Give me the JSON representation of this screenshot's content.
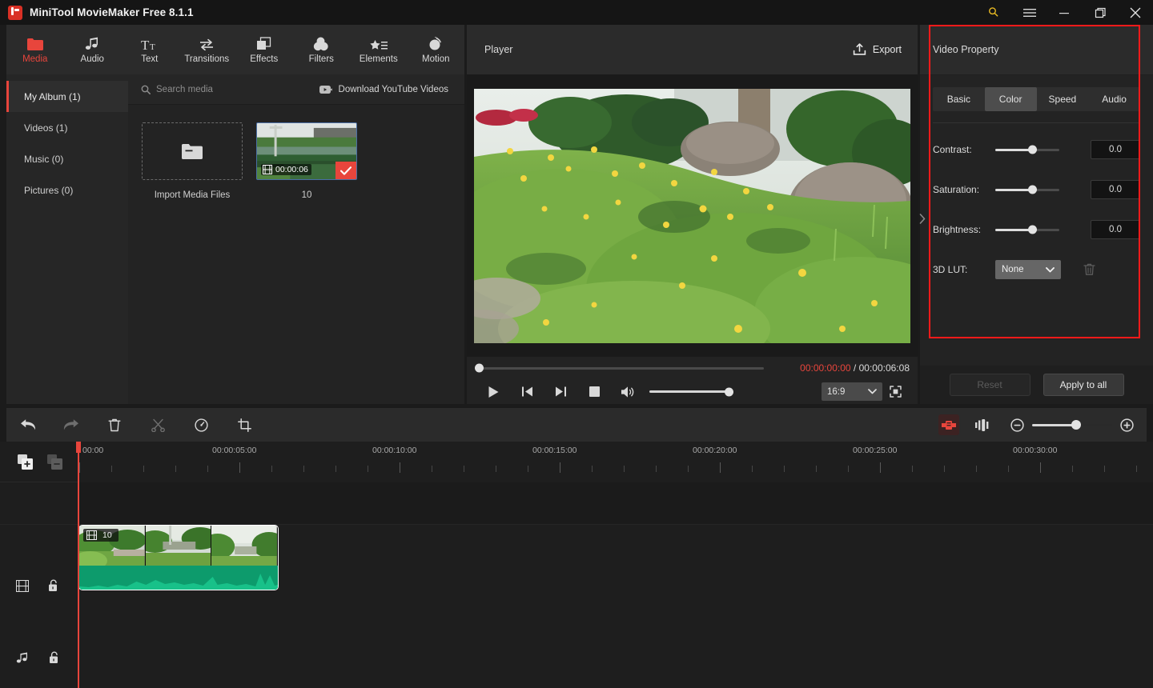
{
  "window": {
    "app_title": "MiniTool MovieMaker Free 8.1.1",
    "controls": {
      "key": "key-icon",
      "menu": "hamburger-menu-icon",
      "minimize": "minimize-icon",
      "maximize": "maximize-icon",
      "close": "close-icon"
    }
  },
  "tabs": [
    {
      "label": "Media",
      "icon": "folder-icon",
      "active": true
    },
    {
      "label": "Audio",
      "icon": "music-note-icon",
      "active": false
    },
    {
      "label": "Text",
      "icon": "text-icon",
      "active": false
    },
    {
      "label": "Transitions",
      "icon": "transitions-icon",
      "active": false
    },
    {
      "label": "Effects",
      "icon": "effects-icon",
      "active": false
    },
    {
      "label": "Filters",
      "icon": "filters-icon",
      "active": false
    },
    {
      "label": "Elements",
      "icon": "elements-icon",
      "active": false
    },
    {
      "label": "Motion",
      "icon": "motion-icon",
      "active": false
    }
  ],
  "library": {
    "categories": [
      {
        "label": "My Album (1)",
        "active": true
      },
      {
        "label": "Videos (1)",
        "active": false
      },
      {
        "label": "Music (0)",
        "active": false
      },
      {
        "label": "Pictures (0)",
        "active": false
      }
    ],
    "search_placeholder": "Search media",
    "youtube_label": "Download YouTube Videos",
    "import_label": "Import Media Files",
    "items": [
      {
        "name": "10",
        "duration": "00:00:06",
        "selected": true
      }
    ]
  },
  "player": {
    "title": "Player",
    "export_label": "Export",
    "current_time": "00:00:00:00",
    "separator": "/",
    "total_time": "00:00:06:08",
    "aspect_ratio": "16:9",
    "seek_position_pct": 0,
    "volume_pct": 100,
    "controls": [
      {
        "name": "play-button"
      },
      {
        "name": "previous-frame-button"
      },
      {
        "name": "next-frame-button"
      },
      {
        "name": "stop-button"
      },
      {
        "name": "volume-button"
      }
    ]
  },
  "property_panel": {
    "header": "Video Property",
    "tabs": [
      {
        "label": "Basic",
        "active": false
      },
      {
        "label": "Color",
        "active": true
      },
      {
        "label": "Speed",
        "active": false
      },
      {
        "label": "Audio",
        "active": false
      }
    ],
    "rows": [
      {
        "label": "Contrast:",
        "value": "0.0",
        "slider_pct": 55
      },
      {
        "label": "Saturation:",
        "value": "0.0",
        "slider_pct": 55
      },
      {
        "label": "Brightness:",
        "value": "0.0",
        "slider_pct": 55
      }
    ],
    "lut": {
      "label": "3D LUT:",
      "value": "None"
    },
    "reset_label": "Reset",
    "reset_disabled": true,
    "apply_label": "Apply to all",
    "highlight_color": "#ff1a1a"
  },
  "timeline": {
    "toolbar": [
      {
        "name": "undo-icon",
        "disabled": false
      },
      {
        "name": "redo-icon",
        "disabled": true
      },
      {
        "name": "delete-icon",
        "disabled": false
      },
      {
        "name": "split-icon",
        "disabled": true
      },
      {
        "name": "speed-icon",
        "disabled": false
      },
      {
        "name": "crop-icon",
        "disabled": false
      }
    ],
    "zoom": {
      "out_label": "−",
      "in_label": "+",
      "level_pct": 50
    },
    "ruler_labels": [
      "00:00",
      "00:00:05:00",
      "00:00:10:00",
      "00:00:15:00",
      "00:00:20:00",
      "00:00:25:00",
      "00:00:30:00"
    ],
    "tracks": [
      {
        "type": "video",
        "icon": "film-strip-icon",
        "lock": "unlock-icon"
      },
      {
        "type": "audio",
        "icon": "music-note-icon",
        "lock": "unlock-icon"
      }
    ],
    "clip": {
      "name": "10",
      "icon": "film-strip-icon"
    },
    "playhead_time": "00:00"
  }
}
